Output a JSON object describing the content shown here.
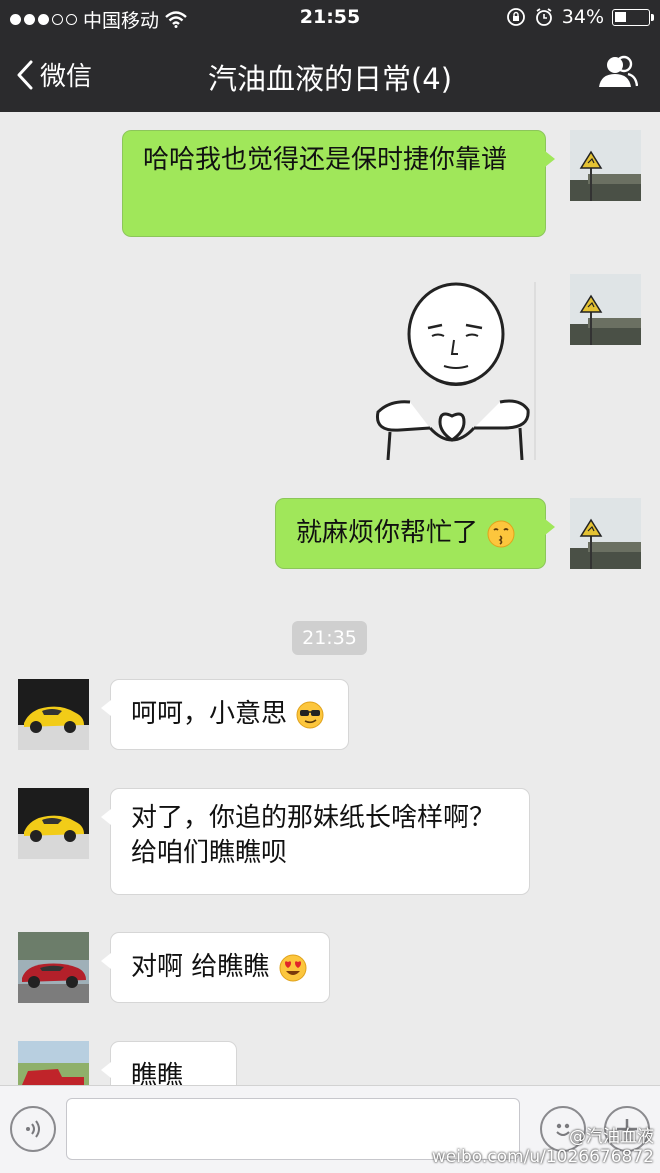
{
  "status_bar": {
    "carrier": "中国移动",
    "time": "21:55",
    "battery": "34%",
    "battery_level": 0.34
  },
  "nav": {
    "back_label": "微信",
    "title": "汽油血液的日常(4)"
  },
  "messages": {
    "m1": "哈哈我也觉得还是保时捷你靠谱",
    "m3": "就麻烦你帮忙了",
    "timestamp": "21:35",
    "m4": "呵呵，小意思",
    "m5": "对了，你追的那妹纸长啥样啊？给咱们瞧瞧呗",
    "m6": "对啊 给瞧瞧",
    "m7": "瞧瞧"
  },
  "watermark": {
    "handle": "@汽油血液",
    "url": "weibo.com/u/1026676872"
  },
  "colors": {
    "header_bg": "#2b2b2d",
    "chat_bg": "#ebebeb",
    "outgoing_bubble": "#a0e75a",
    "incoming_bubble": "#ffffff"
  },
  "icons": [
    "signal-dots-icon",
    "wifi-icon",
    "lock-rotation-icon",
    "alarm-icon",
    "battery-icon",
    "chevron-left-icon",
    "group-members-icon",
    "voice-icon",
    "emoji-icon",
    "plus-icon"
  ]
}
